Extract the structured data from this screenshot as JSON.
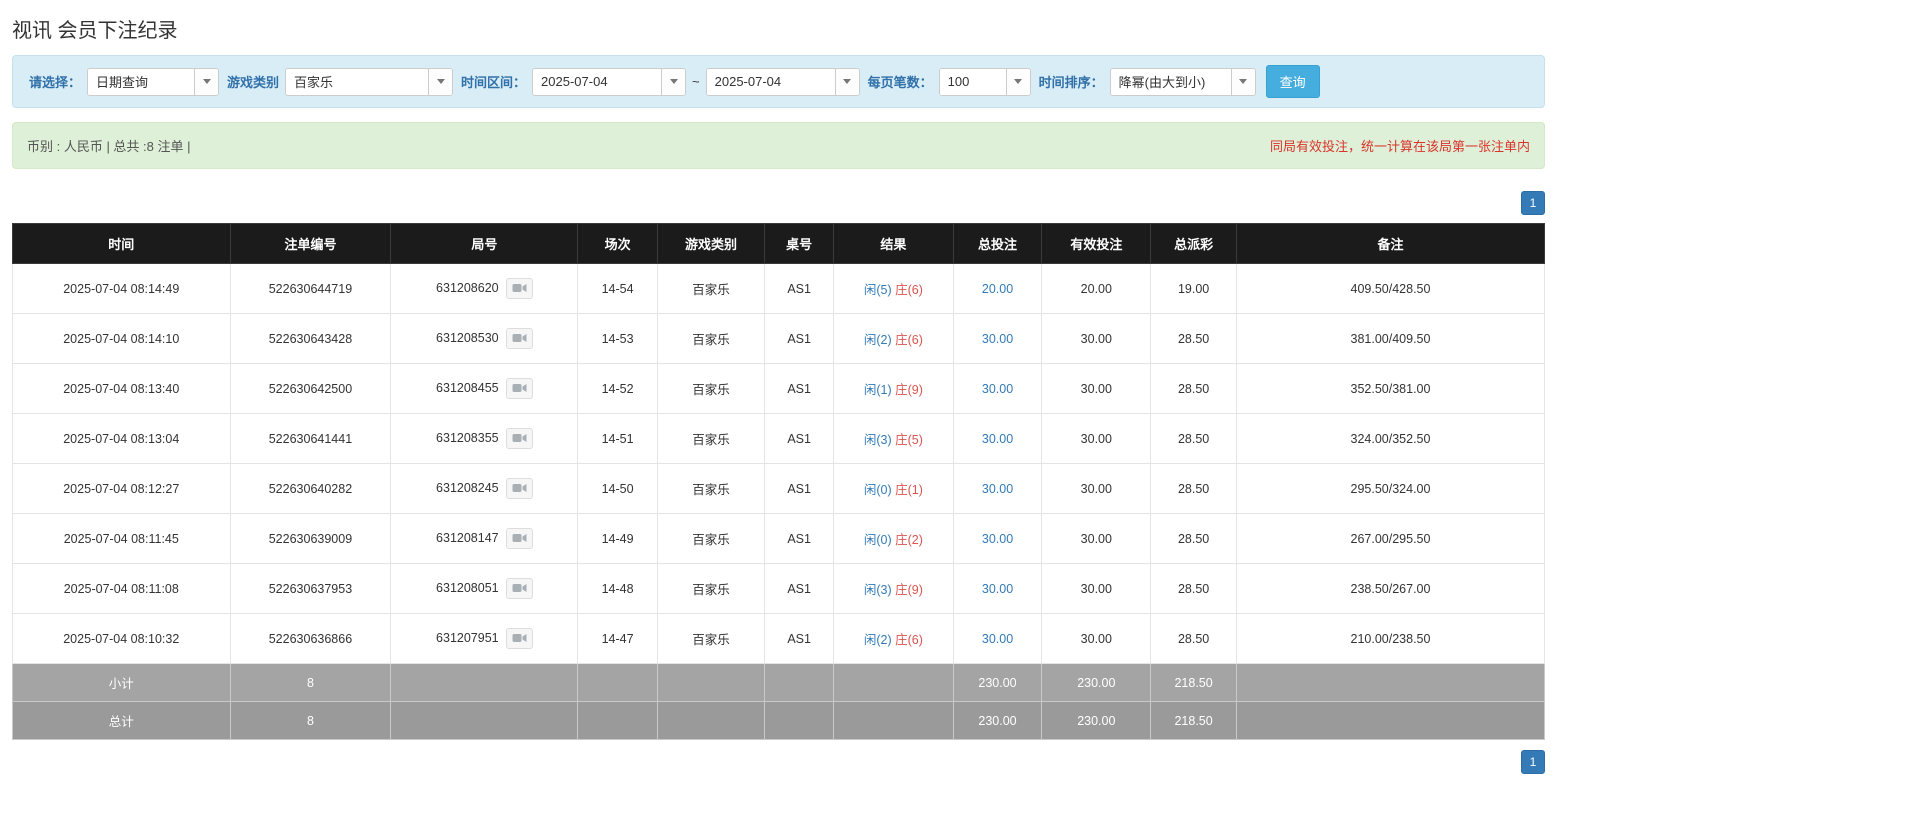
{
  "page": {
    "title": "视讯 会员下注纪录"
  },
  "filters": {
    "select_label": "请选择：",
    "select_value": "日期查询",
    "game_type_label": "游戏类别",
    "game_type_value": "百家乐",
    "time_range_label": "时间区间：",
    "date_from": "2025-07-04",
    "tilde": "~",
    "date_to": "2025-07-04",
    "page_size_label": "每页笔数：",
    "page_size_value": "100",
    "sort_label": "时间排序：",
    "sort_value": "降幂(由大到小)",
    "search_button": "查询"
  },
  "summary": {
    "left": "币别 : 人民币 | 总共 :8 注单 |",
    "right": "同局有效投注，统一计算在该局第一张注单内"
  },
  "pagination": {
    "page": "1"
  },
  "table": {
    "headers": [
      "时间",
      "注单编号",
      "局号",
      "场次",
      "游戏类别",
      "桌号",
      "结果",
      "总投注",
      "有效投注",
      "总派彩",
      "备注"
    ],
    "col_widths": [
      "14.2%",
      "10.5%",
      "12.2%",
      "5.2%",
      "7.0%",
      "4.5%",
      "7.8%",
      "5.8%",
      "7.1%",
      "5.6%",
      "20.1%"
    ],
    "rows": [
      {
        "time": "2025-07-04 08:14:49",
        "bet_id": "522630644719",
        "round_id": "631208620",
        "session": "14-54",
        "game": "百家乐",
        "table_no": "AS1",
        "result_player": "闲(5)",
        "result_banker": "庄(6)",
        "total_bet": "20.00",
        "valid_bet": "20.00",
        "payout": "19.00",
        "remark": "409.50/428.50"
      },
      {
        "time": "2025-07-04 08:14:10",
        "bet_id": "522630643428",
        "round_id": "631208530",
        "session": "14-53",
        "game": "百家乐",
        "table_no": "AS1",
        "result_player": "闲(2)",
        "result_banker": "庄(6)",
        "total_bet": "30.00",
        "valid_bet": "30.00",
        "payout": "28.50",
        "remark": "381.00/409.50"
      },
      {
        "time": "2025-07-04 08:13:40",
        "bet_id": "522630642500",
        "round_id": "631208455",
        "session": "14-52",
        "game": "百家乐",
        "table_no": "AS1",
        "result_player": "闲(1)",
        "result_banker": "庄(9)",
        "total_bet": "30.00",
        "valid_bet": "30.00",
        "payout": "28.50",
        "remark": "352.50/381.00"
      },
      {
        "time": "2025-07-04 08:13:04",
        "bet_id": "522630641441",
        "round_id": "631208355",
        "session": "14-51",
        "game": "百家乐",
        "table_no": "AS1",
        "result_player": "闲(3)",
        "result_banker": "庄(5)",
        "total_bet": "30.00",
        "valid_bet": "30.00",
        "payout": "28.50",
        "remark": "324.00/352.50"
      },
      {
        "time": "2025-07-04 08:12:27",
        "bet_id": "522630640282",
        "round_id": "631208245",
        "session": "14-50",
        "game": "百家乐",
        "table_no": "AS1",
        "result_player": "闲(0)",
        "result_banker": "庄(1)",
        "total_bet": "30.00",
        "valid_bet": "30.00",
        "payout": "28.50",
        "remark": "295.50/324.00"
      },
      {
        "time": "2025-07-04 08:11:45",
        "bet_id": "522630639009",
        "round_id": "631208147",
        "session": "14-49",
        "game": "百家乐",
        "table_no": "AS1",
        "result_player": "闲(0)",
        "result_banker": "庄(2)",
        "total_bet": "30.00",
        "valid_bet": "30.00",
        "payout": "28.50",
        "remark": "267.00/295.50"
      },
      {
        "time": "2025-07-04 08:11:08",
        "bet_id": "522630637953",
        "round_id": "631208051",
        "session": "14-48",
        "game": "百家乐",
        "table_no": "AS1",
        "result_player": "闲(3)",
        "result_banker": "庄(9)",
        "total_bet": "30.00",
        "valid_bet": "30.00",
        "payout": "28.50",
        "remark": "238.50/267.00"
      },
      {
        "time": "2025-07-04 08:10:32",
        "bet_id": "522630636866",
        "round_id": "631207951",
        "session": "14-47",
        "game": "百家乐",
        "table_no": "AS1",
        "result_player": "闲(2)",
        "result_banker": "庄(6)",
        "total_bet": "30.00",
        "valid_bet": "30.00",
        "payout": "28.50",
        "remark": "210.00/238.50"
      }
    ],
    "subtotal": {
      "label": "小计",
      "count": "8",
      "total_bet": "230.00",
      "valid_bet": "230.00",
      "payout": "218.50"
    },
    "total": {
      "label": "总计",
      "count": "8",
      "total_bet": "230.00",
      "valid_bet": "230.00",
      "payout": "218.50"
    }
  },
  "colors": {
    "accent_blue": "#337ab7",
    "filter_bar_bg": "#d9edf7",
    "filter_label": "#3071a9",
    "search_button_bg": "#46aede",
    "summary_bar_bg": "#dff0d8",
    "summary_note_red": "#d9342b",
    "table_header_bg": "#1b1b1b",
    "player_blue": "#337ab7",
    "banker_red": "#d9534f",
    "footer_gray": "#9e9e9e"
  }
}
